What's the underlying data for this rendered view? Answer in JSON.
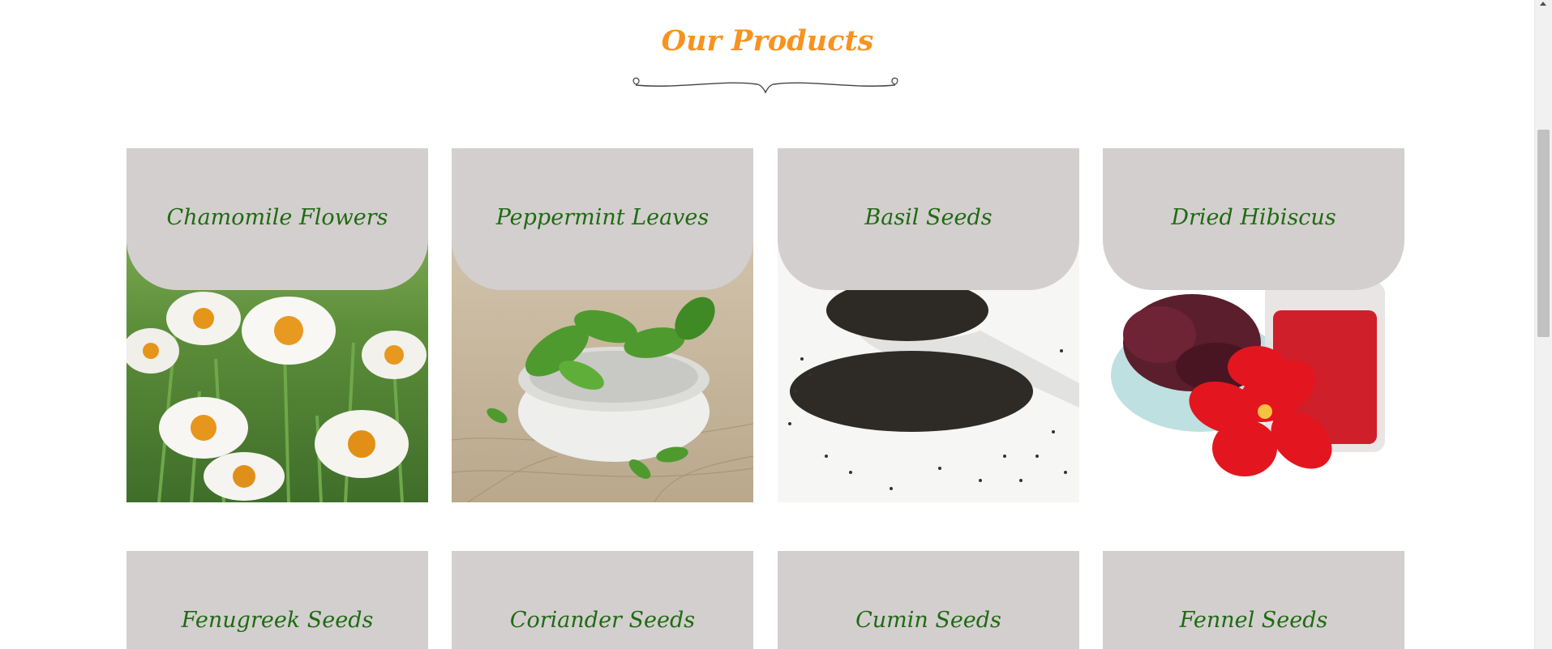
{
  "section": {
    "title": "Our Products"
  },
  "products": [
    {
      "name": "Chamomile Flowers",
      "photo": "chamomile-flowers-photo"
    },
    {
      "name": "Peppermint Leaves",
      "photo": "peppermint-leaves-photo"
    },
    {
      "name": "Basil Seeds",
      "photo": "basil-seeds-photo"
    },
    {
      "name": "Dried Hibiscus",
      "photo": "dried-hibiscus-photo"
    },
    {
      "name": "Fenugreek Seeds",
      "photo": ""
    },
    {
      "name": "Coriander Seeds",
      "photo": ""
    },
    {
      "name": "Cumin Seeds",
      "photo": ""
    },
    {
      "name": "Fennel Seeds",
      "photo": ""
    }
  ],
  "colors": {
    "title": "#f7931e",
    "product_name": "#1e6b12",
    "card_cap": "#d4cfcf"
  }
}
